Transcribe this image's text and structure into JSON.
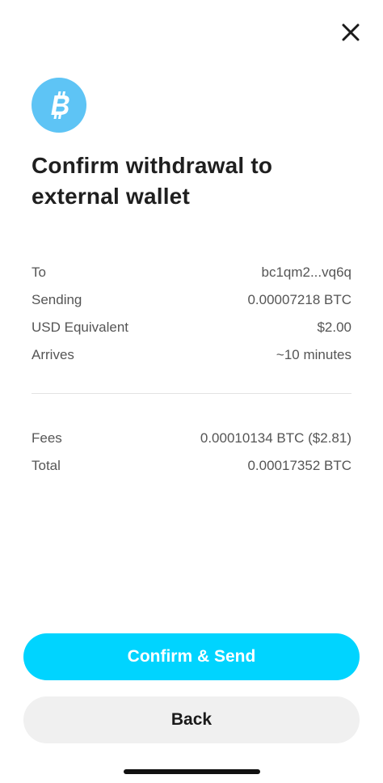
{
  "header": {
    "close_icon": "close-icon",
    "coin_icon": "bitcoin-icon",
    "coin_color": "#5ec4f5"
  },
  "title": "Confirm withdrawal to external wallet",
  "details": [
    {
      "label": "To",
      "value": "bc1qm2...vq6q"
    },
    {
      "label": "Sending",
      "value": "0.00007218 BTC"
    },
    {
      "label": "USD Equivalent",
      "value": "$2.00"
    },
    {
      "label": "Arrives",
      "value": "~10 minutes"
    }
  ],
  "summary": [
    {
      "label": "Fees",
      "value": "0.00010134 BTC ($2.81)"
    },
    {
      "label": "Total",
      "value": "0.00017352 BTC"
    }
  ],
  "actions": {
    "confirm_label": "Confirm & Send",
    "back_label": "Back",
    "confirm_color": "#00d4ff"
  }
}
